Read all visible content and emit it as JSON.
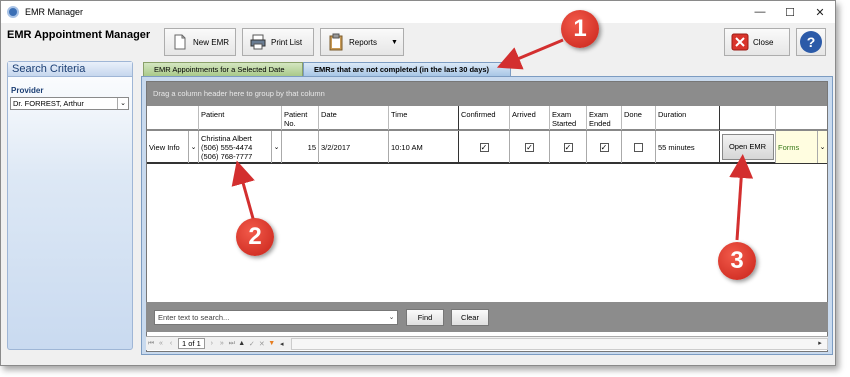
{
  "window": {
    "title": "EMR Manager",
    "minimize": "—",
    "maximize": "☐",
    "close": "✕"
  },
  "header": {
    "app_title": "EMR Appointment Manager"
  },
  "toolbar": {
    "new_emr": "New EMR",
    "print_list": "Print List",
    "reports": "Reports",
    "close": "Close",
    "help": "?"
  },
  "sidebar": {
    "title": "Search Criteria",
    "provider_label": "Provider",
    "provider_value": "Dr. FORREST, Arthur"
  },
  "tabs": [
    {
      "label": "EMR Appointments for a Selected Date"
    },
    {
      "label": "EMRs that are not completed (in the last 30 days)"
    }
  ],
  "grid": {
    "group_hint": "Drag a column header here to group by that column",
    "columns": {
      "patient": "Patient",
      "patient_no_1": "Patient",
      "patient_no_2": "No.",
      "date": "Date",
      "time": "Time",
      "confirmed": "Confirmed",
      "arrived": "Arrived",
      "exam_started_1": "Exam",
      "exam_started_2": "Started",
      "exam_ended_1": "Exam",
      "exam_ended_2": "Ended",
      "done": "Done",
      "duration": "Duration"
    },
    "row": {
      "view_info": "View Info",
      "patient_name": "Christina Albert",
      "phone1": "(506) 555-4474",
      "phone2": "(506) 768-7777",
      "patient_no": "15",
      "date": "3/2/2017",
      "time": "10:10 AM",
      "confirmed": true,
      "arrived": true,
      "exam_started": true,
      "exam_ended": true,
      "done": false,
      "duration": "55 minutes",
      "open_emr": "Open EMR",
      "forms": "Forms"
    }
  },
  "findbar": {
    "placeholder": "Enter text to search...",
    "find": "Find",
    "clear": "Clear"
  },
  "pager": {
    "page_text": "1 of 1"
  },
  "annotations": {
    "one": "1",
    "two": "2",
    "three": "3",
    "color": "#d32f2f"
  }
}
